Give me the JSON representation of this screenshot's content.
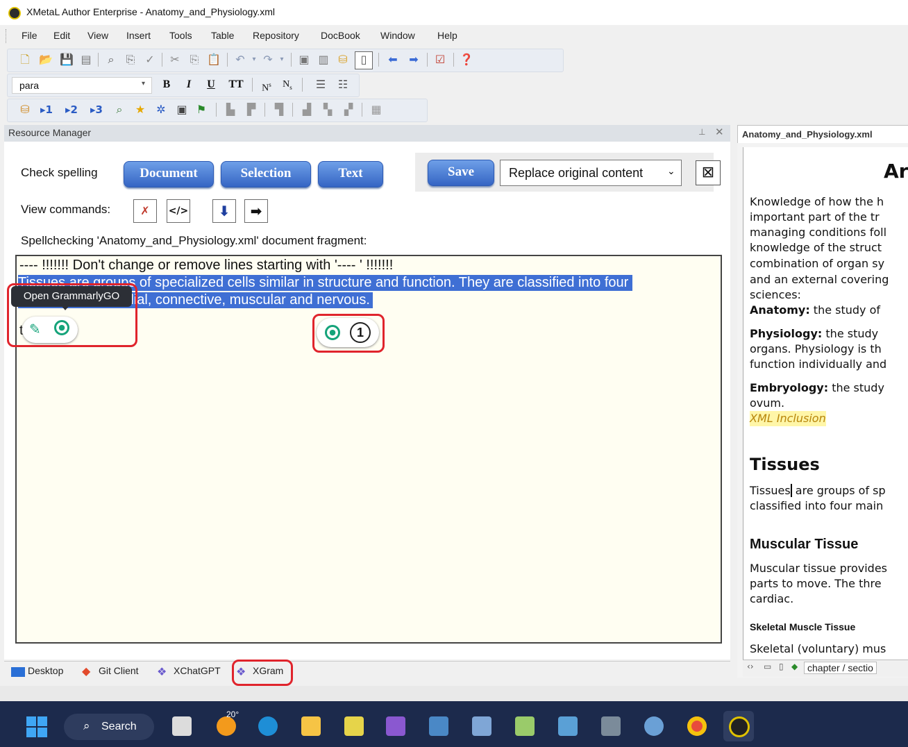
{
  "window": {
    "title": "XMetaL Author Enterprise - Anatomy_and_Physiology.xml"
  },
  "menu": [
    "File",
    "Edit",
    "View",
    "Insert",
    "Tools",
    "Table",
    "Repository",
    "DocBook",
    "Window",
    "Help"
  ],
  "formatting_toolbar": {
    "element_select": "para",
    "bold": "B",
    "italic": "I",
    "underline": "U",
    "teletype": "TT",
    "superscript": "N",
    "superscript_sub": "s",
    "subscript": "N",
    "subscript_sub": "s"
  },
  "nav_toolbar": {
    "h1": "1",
    "h2": "2",
    "h3": "3"
  },
  "resource_manager": {
    "title": "Resource Manager",
    "check_spelling_label": "Check spelling",
    "document_button": "Document",
    "selection_button": "Selection",
    "text_button": "Text",
    "save_button": "Save",
    "save_mode_select": "Replace original content",
    "view_commands_label": "View commands:",
    "fragment_label": "Spellchecking 'Anatomy_and_Physiology.xml' document fragment:",
    "editor_lines": [
      "---- !!!!!!!    Don't change or remove lines starting with '---- '    !!!!!!!",
      "Tissues are groups of specialized cells similar in structure and function. They are classified into four",
      "main types: epithelial, connective, muscular and nervous.",
      "t",
      "----"
    ],
    "grammarly_tooltip": "Open GrammarlyGO",
    "suggestion_count": "1"
  },
  "right_pane": {
    "tab_title": "Anatomy_and_Physiology.xml",
    "heading_fragment": "Ar",
    "intro_lines": [
      "Knowledge of how the h",
      "important part of the tr",
      "managing conditions foll",
      "knowledge of the struct",
      "combination of organ sy",
      "and an external covering",
      "sciences:"
    ],
    "anatomy_term": "Anatomy:",
    "anatomy_text": " the study of",
    "physiology_term": "Physiology:",
    "physiology_text": "  the study",
    "physiology_lines": [
      "organs. Physiology is th",
      "function individually and"
    ],
    "embryology_term": "Embryology:",
    "embryology_text": "  the study",
    "embryology_line2": "ovum.",
    "xml_inclusion": "XML Inclusion",
    "tissues_heading": "Tissues",
    "tissues_line1a": "Tissues",
    "tissues_line1b": " are groups of sp",
    "tissues_line2": "classified into four main",
    "muscular_heading": "Muscular Tissue",
    "muscular_lines": [
      "Muscular tissue provides",
      "parts to move. The thre",
      "cardiac."
    ],
    "skeletal_heading": "Skeletal Muscle Tissue",
    "skeletal_line": "Skeletal (voluntary) mus",
    "breadcrumb": "chapter / sectio"
  },
  "bottom_tabs": [
    "Desktop",
    "Git Client",
    "XChatGPT",
    "XGram"
  ],
  "taskbar": {
    "search_label": "Search",
    "weather": "20°"
  }
}
